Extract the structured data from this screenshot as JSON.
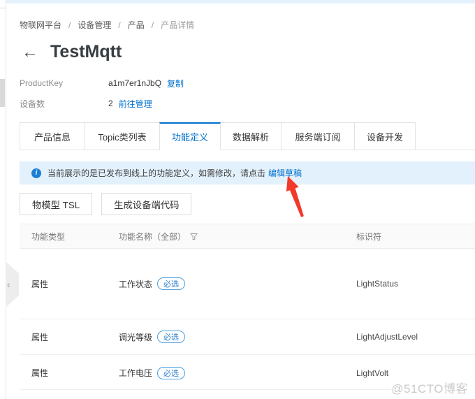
{
  "breadcrumb": {
    "items": [
      "物联网平台",
      "设备管理",
      "产品"
    ],
    "current": "产品详情",
    "separator": "/"
  },
  "header": {
    "back_icon": "←",
    "title": "TestMqtt"
  },
  "meta": {
    "rows": [
      {
        "label": "ProductKey",
        "value": "a1m7er1nJbQ",
        "action": "复制"
      },
      {
        "label": "设备数",
        "value": "2",
        "action": "前往管理"
      }
    ]
  },
  "tabs": {
    "items": [
      {
        "label": "产品信息"
      },
      {
        "label": "Topic类列表"
      },
      {
        "label": "功能定义"
      },
      {
        "label": "数据解析"
      },
      {
        "label": "服务端订阅"
      },
      {
        "label": "设备开发"
      }
    ],
    "active_label": "功能定义"
  },
  "banner": {
    "info_icon": "i",
    "text": "当前展示的是已发布到线上的功能定义，如需修改，请点击",
    "link": "编辑草稿"
  },
  "toolbar": {
    "tsl_button": "物模型 TSL",
    "codegen_button": "生成设备端代码"
  },
  "table": {
    "columns": {
      "type": "功能类型",
      "name": "功能名称（全部）",
      "identifier": "标识符"
    },
    "rows": [
      {
        "type": "属性",
        "name": "工作状态",
        "badge": "必选",
        "identifier": "LightStatus"
      },
      {
        "type": "属性",
        "name": "调光等级",
        "badge": "必选",
        "identifier": "LightAdjustLevel"
      },
      {
        "type": "属性",
        "name": "工作电压",
        "badge": "必选",
        "identifier": "LightVolt"
      }
    ]
  },
  "sidebar": {
    "collapse_icon": "‹"
  },
  "watermark": "@51CTO博客",
  "colors": {
    "accent": "#0070cc",
    "banner_bg": "#e3f1fc",
    "active_tab": "#0070cc",
    "annotation_arrow": "#f2392c",
    "badge_border": "#4b9fe0",
    "top_strip": "#e4f2fd"
  }
}
